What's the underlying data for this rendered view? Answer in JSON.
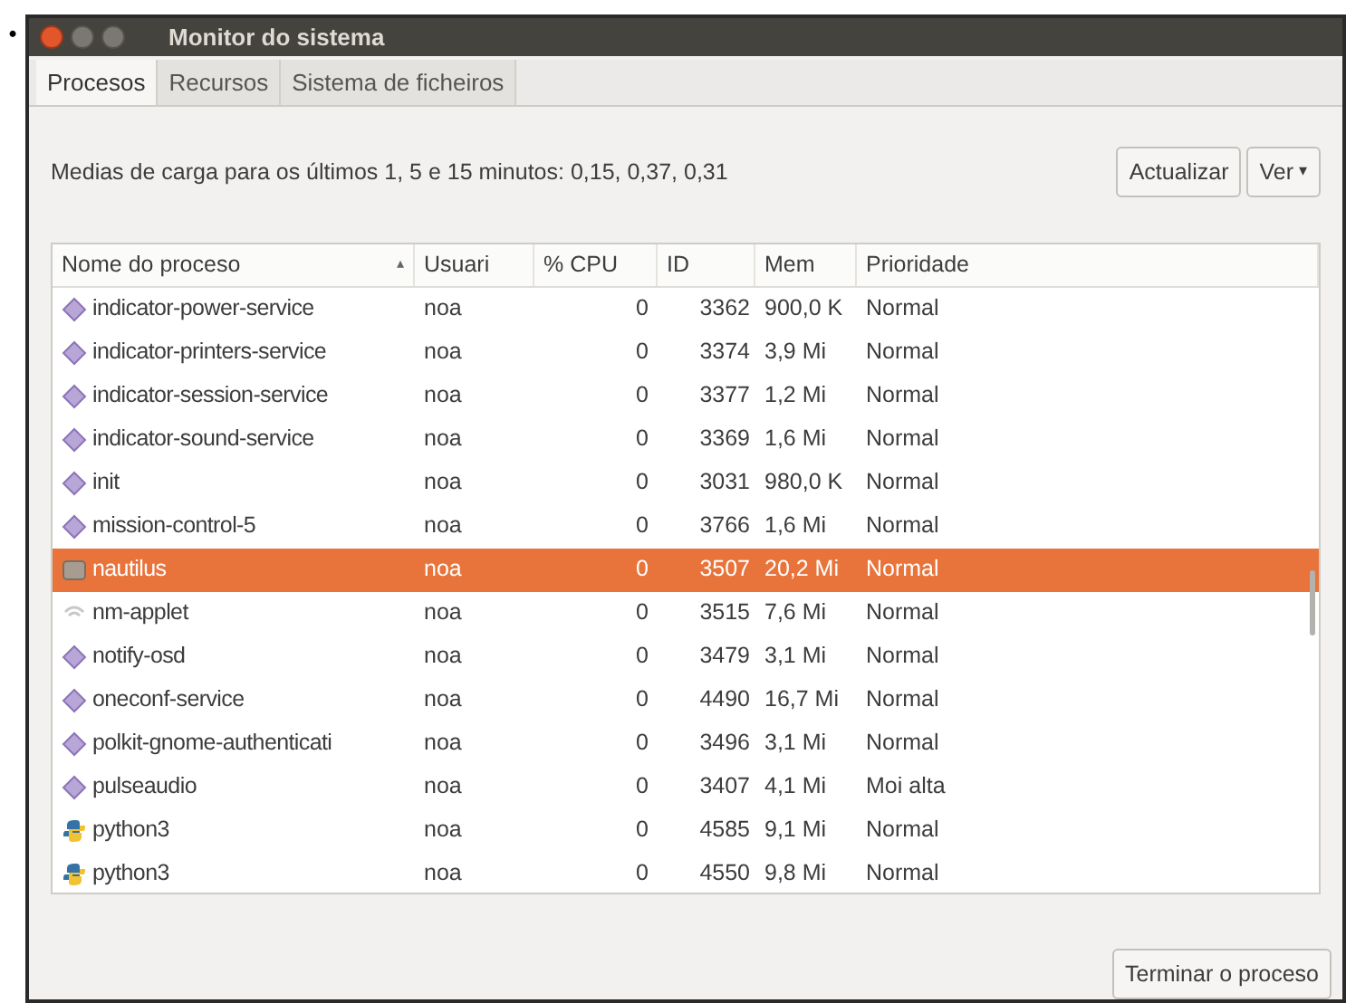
{
  "bullet": "•",
  "window": {
    "title": "Monitor do sistema"
  },
  "tabs": [
    {
      "label": "Procesos",
      "selected": true
    },
    {
      "label": "Recursos",
      "selected": false
    },
    {
      "label": "Sistema de ficheiros",
      "selected": false
    }
  ],
  "load_text": "Medias de carga para os últimos 1, 5 e 15 minutos: 0,15, 0,37, 0,31",
  "buttons": [
    {
      "label": "Actualizar",
      "kind": "plain"
    },
    {
      "label": "Ver",
      "kind": "menu",
      "caret": "▾"
    }
  ],
  "table": {
    "columns": [
      {
        "label": "Nome do proceso",
        "sort": "▴"
      },
      {
        "label": "Usuari"
      },
      {
        "label": "% CPU"
      },
      {
        "label": "ID"
      },
      {
        "label": "Mem"
      },
      {
        "label": "Prioridade"
      }
    ],
    "rows": [
      {
        "kind": "process",
        "cells": [
          "indicator-power-service",
          "noa",
          "0",
          "3362",
          "900,0 K",
          "Normal"
        ],
        "selected": false
      },
      {
        "kind": "process",
        "cells": [
          "indicator-printers-service",
          "noa",
          "0",
          "3374",
          "3,9 Mi",
          "Normal"
        ],
        "selected": false
      },
      {
        "kind": "process",
        "cells": [
          "indicator-session-service",
          "noa",
          "0",
          "3377",
          "1,2 Mi",
          "Normal"
        ],
        "selected": false
      },
      {
        "kind": "process",
        "cells": [
          "indicator-sound-service",
          "noa",
          "0",
          "3369",
          "1,6 Mi",
          "Normal"
        ],
        "selected": false
      },
      {
        "kind": "process",
        "cells": [
          "init",
          "noa",
          "0",
          "3031",
          "980,0 K",
          "Normal"
        ],
        "selected": false
      },
      {
        "kind": "process",
        "cells": [
          "mission-control-5",
          "noa",
          "0",
          "3766",
          "1,6 Mi",
          "Normal"
        ],
        "selected": false
      },
      {
        "kind": "folder",
        "cells": [
          "nautilus",
          "noa",
          "0",
          "3507",
          "20,2 Mi",
          "Normal"
        ],
        "selected": true
      },
      {
        "kind": "network",
        "cells": [
          "nm-applet",
          "noa",
          "0",
          "3515",
          "7,6 Mi",
          "Normal"
        ],
        "selected": false
      },
      {
        "kind": "process",
        "cells": [
          "notify-osd",
          "noa",
          "0",
          "3479",
          "3,1 Mi",
          "Normal"
        ],
        "selected": false
      },
      {
        "kind": "process",
        "cells": [
          "oneconf-service",
          "noa",
          "0",
          "4490",
          "16,7 Mi",
          "Normal"
        ],
        "selected": false
      },
      {
        "kind": "process",
        "cells": [
          "polkit-gnome-authenticati",
          "noa",
          "0",
          "3496",
          "3,1 Mi",
          "Normal"
        ],
        "selected": false
      },
      {
        "kind": "process",
        "cells": [
          "pulseaudio",
          "noa",
          "0",
          "3407",
          "4,1 Mi",
          "Moi alta"
        ],
        "selected": false
      },
      {
        "kind": "python",
        "cells": [
          "python3",
          "noa",
          "0",
          "4585",
          "9,1 Mi",
          "Normal"
        ],
        "selected": false
      },
      {
        "kind": "python",
        "cells": [
          "python3",
          "noa",
          "0",
          "4550",
          "9,8 Mi",
          "Normal"
        ],
        "selected": false
      }
    ]
  },
  "end_button": {
    "label": "Terminar o proceso"
  }
}
